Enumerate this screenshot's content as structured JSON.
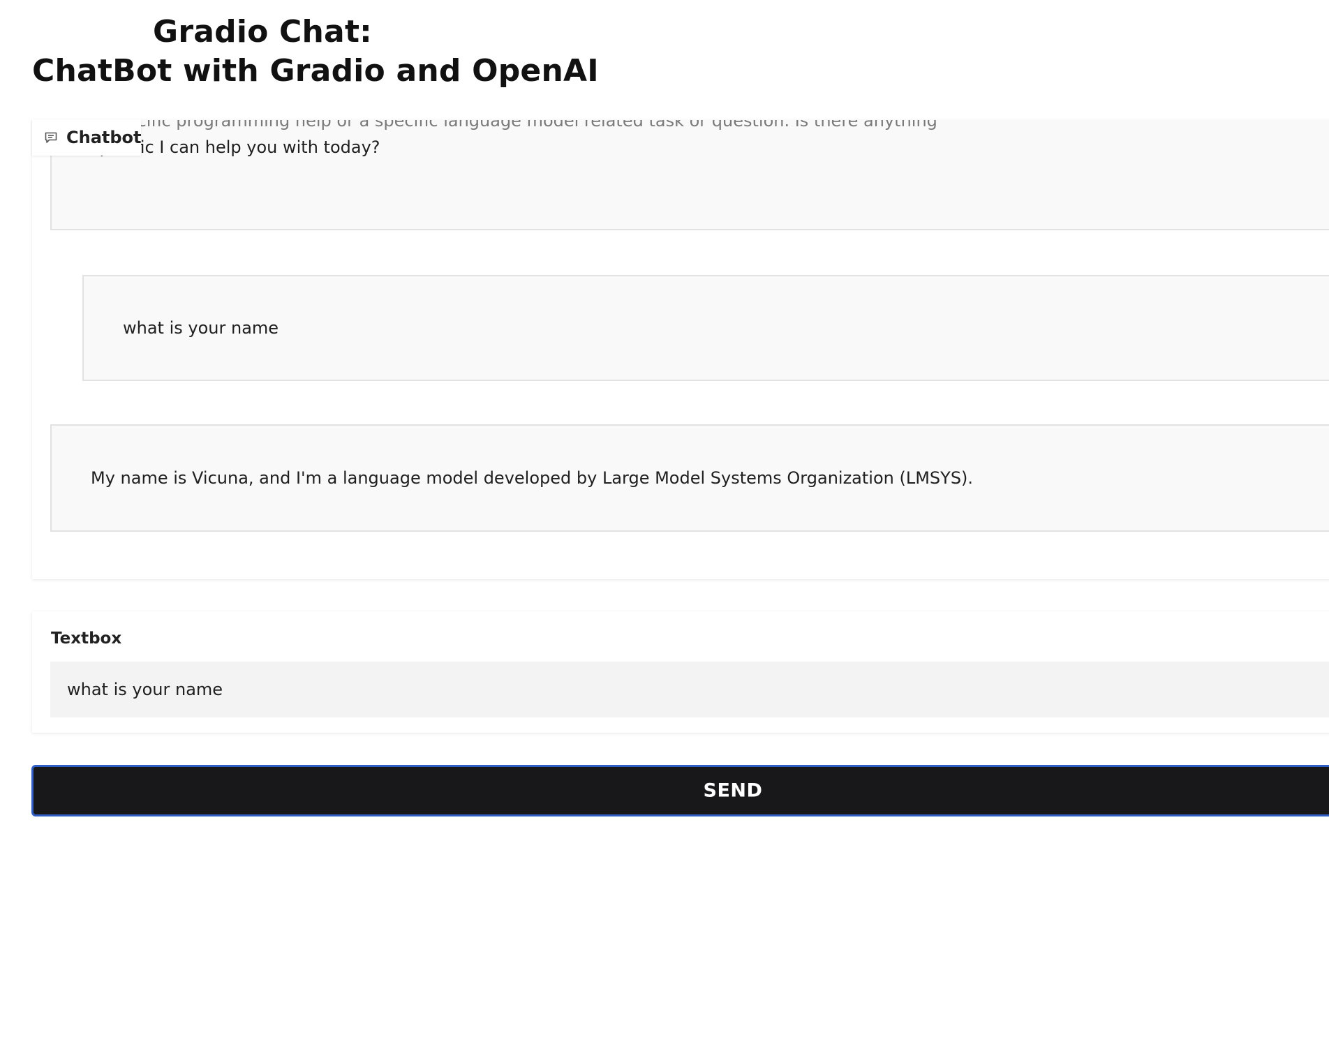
{
  "header": {
    "title_line1": "Gradio Chat:",
    "title_line2": "ChatBot with Gradio and OpenAI"
  },
  "chatbot": {
    "label": "Chatbot",
    "icon": "chat-bubble-icon",
    "messages": [
      {
        "role": "bot",
        "text_cut": "…specific programming help or a specific language model related task or question. Is there anything",
        "text_visible": "specific I can help you with today?"
      },
      {
        "role": "user",
        "text": "what is your name"
      },
      {
        "role": "bot",
        "text": "My name is Vicuna, and I'm a language model developed by Large Model Systems Organization (LMSYS)."
      }
    ]
  },
  "textbox": {
    "label": "Textbox",
    "value": "what is your name"
  },
  "send_button": {
    "label": "SEND"
  },
  "colors": {
    "send_bg": "#18181a",
    "send_border": "#2f5fc4",
    "message_bg": "#f9f9f9",
    "input_bg": "#f3f3f3"
  }
}
